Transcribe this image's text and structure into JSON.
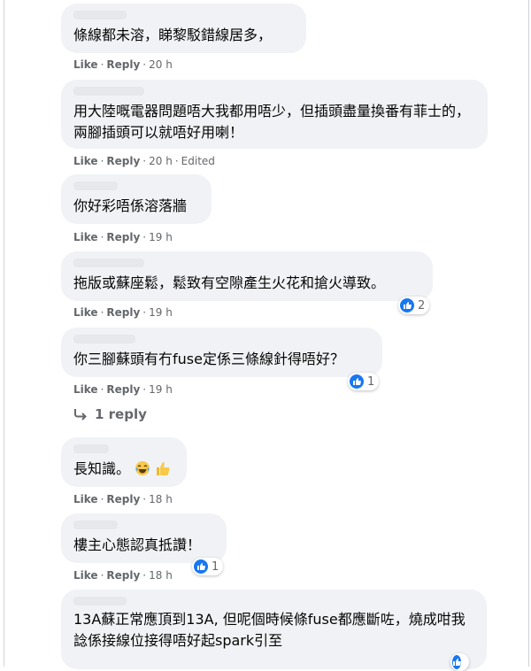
{
  "comments": [
    {
      "text": "條線都未溶，睇黎駁錯線居多，",
      "like": "Like",
      "reply": "Reply",
      "time": "20 h",
      "edited": ""
    },
    {
      "text": "用大陸嘅電器問題唔大我都用唔少，但插頭盡量換番有菲士的，兩腳插頭可以就唔好用喇！",
      "like": "Like",
      "reply": "Reply",
      "time": "20 h",
      "edited": "Edited"
    },
    {
      "text": "你好彩唔係溶落牆",
      "like": "Like",
      "reply": "Reply",
      "time": "19 h",
      "edited": ""
    },
    {
      "text": "拖版或蘇座鬆，鬆致有空隙產生火花和搶火導致。",
      "like": "Like",
      "reply": "Reply",
      "time": "19 h",
      "edited": "",
      "reactions": "2"
    },
    {
      "text": "你三腳蘇頭有冇fuse定係三條線針得唔好？",
      "like": "Like",
      "reply": "Reply",
      "time": "19 h",
      "edited": "",
      "reactions": "1"
    },
    {
      "text": "長知識。",
      "like": "Like",
      "reply": "Reply",
      "time": "18 h",
      "edited": ""
    },
    {
      "text": "樓主心態認真抵讚！",
      "like": "Like",
      "reply": "Reply",
      "time": "18 h",
      "edited": "",
      "reactions": "1"
    },
    {
      "text": "13A蘇正常應頂到13A, 但呢個時候條fuse都應斷咗，燒成咁我諗係接線位接得唔好起spark引至"
    }
  ],
  "replies_link": "1 reply",
  "icons": {
    "like_reaction": "thumbs-up-icon",
    "reply_arrow": "reply-arrow-icon",
    "laugh_emoji": "laughing-emoji-icon",
    "thumbs_emoji": "thumbs-up-emoji-icon"
  },
  "colors": {
    "bubble": "#f0f2f5",
    "meta_text": "#65676b",
    "like_blue": "#1877f2"
  }
}
